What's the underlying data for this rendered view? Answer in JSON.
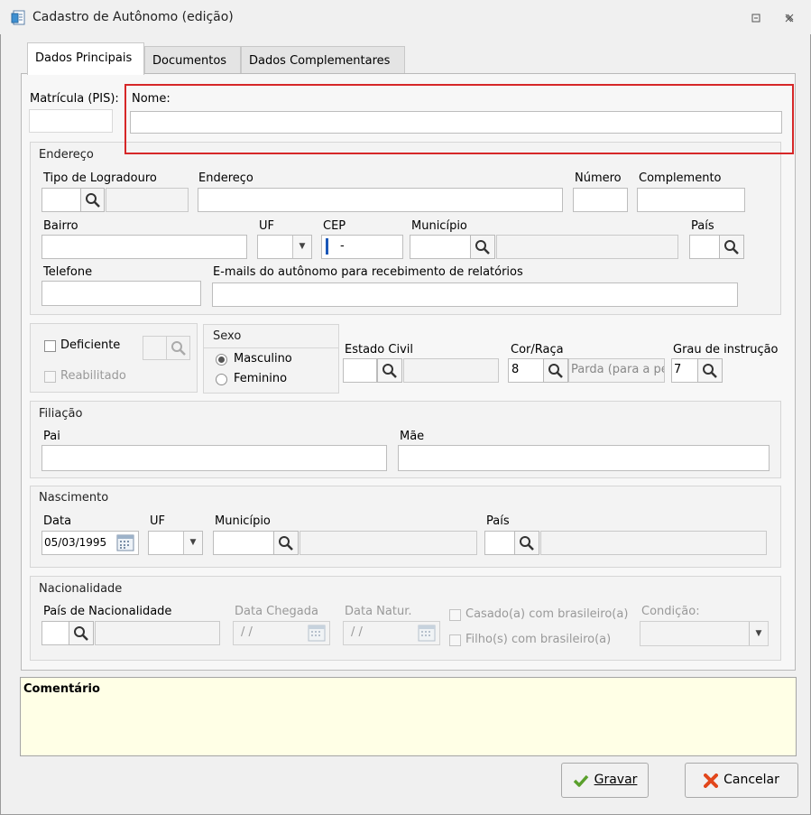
{
  "window": {
    "title": "Cadastro de Autônomo (edição)"
  },
  "tabs": [
    {
      "label": "Dados Principais",
      "active": true
    },
    {
      "label": "Documentos",
      "active": false
    },
    {
      "label": "Dados Complementares",
      "active": false
    }
  ],
  "top": {
    "matricula_label": "Matrícula (PIS):",
    "nome_label": "Nome:",
    "matricula_value": "",
    "nome_value": ""
  },
  "endereco": {
    "group": "Endereço",
    "tipo_logradouro": "Tipo de Logradouro",
    "endereco": "Endereço",
    "numero": "Número",
    "complemento": "Complemento",
    "bairro": "Bairro",
    "uf": "UF",
    "cep": "CEP",
    "cep_value": "-",
    "municipio": "Município",
    "pais": "País",
    "telefone": "Telefone",
    "emails": "E-mails do autônomo para recebimento de relatórios"
  },
  "pessoal": {
    "deficiente": "Deficiente",
    "reabilitado": "Reabilitado",
    "sexo": "Sexo",
    "masculino": "Masculino",
    "feminino": "Feminino",
    "sexo_selected": "Masculino",
    "estado_civil": "Estado Civil",
    "cor_raca": "Cor/Raça",
    "cor_raca_code": "8",
    "cor_raca_desc": "Parda (para a pe",
    "grau_instrucao": "Grau de instrução",
    "grau_instrucao_code": "7"
  },
  "filiacao": {
    "group": "Filiação",
    "pai": "Pai",
    "mae": "Mãe"
  },
  "nascimento": {
    "group": "Nascimento",
    "data": "Data",
    "data_value": "05/03/1995",
    "uf": "UF",
    "municipio": "Município",
    "pais": "País"
  },
  "nacionalidade": {
    "group": "Nacionalidade",
    "pais": "País de Nacionalidade",
    "data_chegada": "Data Chegada",
    "data_chegada_value": "/ /",
    "data_natur": "Data Natur.",
    "data_natur_value": "/ /",
    "casado": "Casado(a) com brasileiro(a)",
    "filhos": "Filho(s) com brasileiro(a)",
    "condicao": "Condição:"
  },
  "comentario": {
    "label": "Comentário",
    "value": ""
  },
  "buttons": {
    "gravar": "Gravar",
    "cancelar": "Cancelar"
  },
  "colors": {
    "highlight": "#d62728",
    "comment_bg": "#ffffe6",
    "gravar_icon": "#5aa02c",
    "cancelar_icon": "#e2471c"
  },
  "icons": {
    "window": "document-form-icon",
    "search": "search-icon",
    "calendar": "calendar-icon",
    "dropdown": "chevron-down-icon",
    "check": "checkmark-icon",
    "cancel": "x-icon"
  }
}
